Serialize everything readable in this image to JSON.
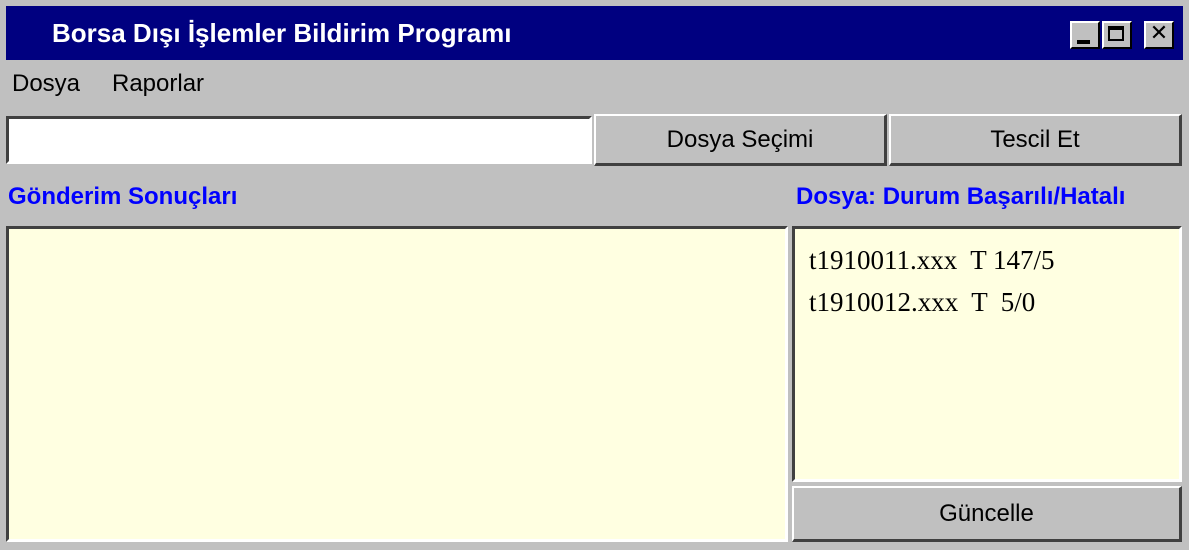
{
  "window": {
    "title": "Borsa Dışı İşlemler Bildirim Programı",
    "controls": {
      "minimize": "_",
      "maximize": "□",
      "close": "✕"
    }
  },
  "menu": {
    "items": [
      "Dosya",
      "Raporlar"
    ]
  },
  "file_row": {
    "path_value": "",
    "select_file_label": "Dosya Seçimi",
    "register_label": "Tescil Et"
  },
  "results": {
    "label": "Gönderim Sonuçları",
    "lines": []
  },
  "status": {
    "label": "Dosya: Durum Başarılı/Hatalı",
    "lines": [
      "t1910011.xxx  T 147/5",
      "t1910012.xxx  T  5/0"
    ],
    "refresh_label": "Güncelle"
  },
  "colors": {
    "titlebar": "#000080",
    "window_bg": "#c0c0c0",
    "panel_bg": "#ffffe1",
    "label_blue": "#0000ff"
  }
}
